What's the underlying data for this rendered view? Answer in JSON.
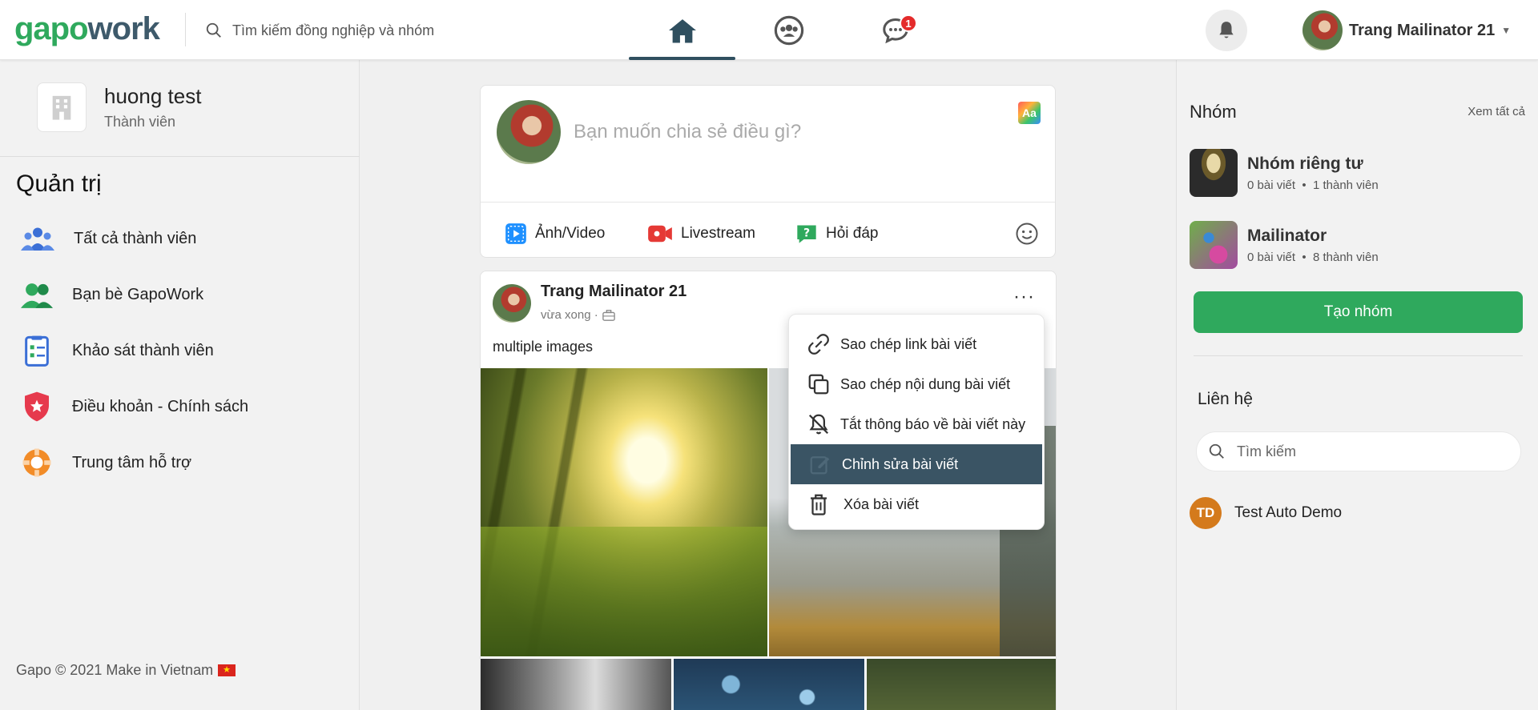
{
  "header": {
    "logo_part1": "gapo",
    "logo_part2": "work",
    "search_placeholder": "Tìm kiếm đồng nghiệp và nhóm",
    "messages_badge": "1",
    "user_name": "Trang Mailinator 21",
    "icons": [
      "search-icon",
      "home-icon",
      "groups-icon",
      "chat-icon",
      "bell-icon",
      "chevron-down-icon"
    ]
  },
  "left": {
    "org_name": "huong test",
    "org_role": "Thành viên",
    "admin_title": "Quản trị",
    "menu": [
      {
        "label": "Tất cả thành viên",
        "icon": "members-icon",
        "color": "#3b6fd6"
      },
      {
        "label": "Bạn bè GapoWork",
        "icon": "friends-icon",
        "color": "#2fa95d"
      },
      {
        "label": "Khảo sát thành viên",
        "icon": "survey-icon",
        "color": "#3b6fd6"
      },
      {
        "label": "Điều khoản - Chính sách",
        "icon": "shield-star-icon",
        "color": "#e63a4d"
      },
      {
        "label": "Trung tâm hỗ trợ",
        "icon": "lifebuoy-icon",
        "color": "#f28c28"
      }
    ],
    "footer": "Gapo © 2021 Make in Vietnam"
  },
  "composer": {
    "placeholder": "Bạn muốn chia sẻ điều gì?",
    "format_label": "Aa",
    "actions": [
      {
        "label": "Ảnh/Video",
        "icon": "photo-video-icon",
        "color": "#1e90ff"
      },
      {
        "label": "Livestream",
        "icon": "livestream-icon",
        "color": "#e53935"
      },
      {
        "label": "Hỏi đáp",
        "icon": "qa-icon",
        "color": "#2fa95d"
      }
    ]
  },
  "post": {
    "author": "Trang Mailinator 21",
    "time": "vừa xong ·",
    "content": "multiple images",
    "more": "···"
  },
  "dropdown": {
    "items": [
      {
        "label": "Sao chép link bài viết",
        "icon": "link-icon"
      },
      {
        "label": "Sao chép nội dung bài viết",
        "icon": "copy-icon"
      },
      {
        "label": "Tắt thông báo về bài viết này",
        "icon": "bell-off-icon"
      },
      {
        "label": "Chỉnh sửa bài viết",
        "icon": "edit-icon"
      },
      {
        "label": "Xóa bài viết",
        "icon": "trash-icon"
      }
    ]
  },
  "right": {
    "groups_title": "Nhóm",
    "see_all": "Xem tất cả",
    "groups": [
      {
        "name": "Nhóm riêng tư",
        "posts": "0 bài viết",
        "members": "1 thành viên"
      },
      {
        "name": "Mailinator",
        "posts": "0 bài viết",
        "members": "8 thành viên"
      }
    ],
    "create_group": "Tạo nhóm",
    "contacts_title": "Liên hệ",
    "contacts_search": "Tìm kiếm",
    "contacts": [
      {
        "initials": "TD",
        "name": "Test Auto Demo"
      }
    ]
  },
  "colors": {
    "brand_green": "#2fa95d",
    "brand_dark": "#3e5a6b",
    "active_menu": "#3a5464",
    "badge": "#e42b2b"
  }
}
